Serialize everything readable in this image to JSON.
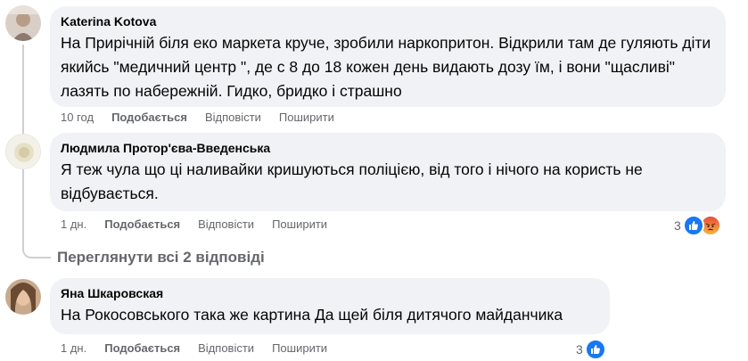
{
  "comments": [
    {
      "author": "Katerina Kotova",
      "text": "На Прирічній біля еко маркета круче, зробили наркопритон. Відкрили там де гуляють діти якийсь \"медичний центр \", де с 8 до 18 кожен день видають дозу їм, і вони \"щасливі\" лазять по набережній. Гидко, бридко і страшно",
      "time": "10 год",
      "like": "Подобається",
      "reply": "Відповісти",
      "share": "Поширити"
    },
    {
      "author": "Людмила Протор'єва-Введенська",
      "text": "Я теж чула що ці наливайки кришуються поліцією, від того і нічого на користь не відбувається.",
      "time": "1 дн.",
      "like": "Подобається",
      "reply": "Відповісти",
      "share": "Поширити",
      "reaction_count": "3",
      "reactions": [
        "like-icon",
        "angry-icon"
      ]
    },
    {
      "author": "Яна Шкаровская",
      "text": "На Рокосовського така же картина Да щей біля дитячого майданчика",
      "time": "1 дн.",
      "like": "Подобається",
      "reply": "Відповісти",
      "share": "Поширити",
      "reaction_count": "3",
      "reactions": [
        "like-icon"
      ]
    }
  ],
  "view_replies": "Переглянути всі 2 відповіді",
  "colors": {
    "bubble": "#f0f2f5",
    "secondary_text": "#65676b",
    "like_blue": "#1877f2",
    "angry_orange": "#f0701d"
  }
}
